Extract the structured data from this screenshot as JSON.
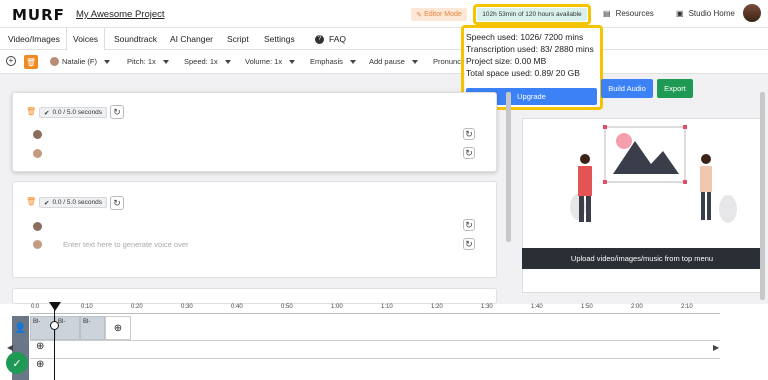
{
  "header": {
    "logo": "MURF",
    "project_title": "My Awesome Project",
    "editor_mode": "Editor Mode",
    "hours_available": "102h 53min of 120 hours available",
    "resources": "Resources",
    "studio_home": "Studio Home"
  },
  "tabs": [
    "Video/Images",
    "Voices",
    "Soundtrack",
    "AI Changer",
    "Script",
    "Settings",
    "FAQ"
  ],
  "toolbar": {
    "voice": "Natalie (F)",
    "pitch": "Pitch: 1x",
    "speed": "Speed: 1x",
    "volume": "Volume: 1x",
    "emphasis": "Emphasis",
    "add_pause": "Add pause",
    "pronunciation": "Pronunci"
  },
  "usage_popup": {
    "speech": "Speech used: 1026/ 7200 mins",
    "transcription": "Transcription used: 83/ 2880 mins",
    "project_size": "Project size: 0.00 MB",
    "total_space": "Total space used: 0.89/ 20 GB",
    "upgrade": "Upgrade"
  },
  "actions": {
    "build_audio": "Build Audio",
    "export": "Export"
  },
  "blocks": [
    {
      "timing": "0.0 / 5.0 seconds"
    },
    {
      "timing": "0.0 / 5.0 seconds",
      "placeholder": "Enter text here to generate voice over"
    }
  ],
  "preview": {
    "upload_msg": "Upload video/images/music from top menu"
  },
  "timeline": {
    "ticks": [
      "0:0",
      "0:10",
      "0:20",
      "0:30",
      "0:40",
      "0:50",
      "1:00",
      "1:10",
      "1:20",
      "1:30",
      "1:40",
      "1:50",
      "2:00",
      "2:10"
    ],
    "clips": [
      "Bl-",
      "Bl-",
      "Bl-"
    ]
  },
  "colors": {
    "accent_blue": "#3c82f6",
    "export_green": "#1f9a54",
    "highlight": "#f5c400",
    "orange": "#f08a24"
  }
}
